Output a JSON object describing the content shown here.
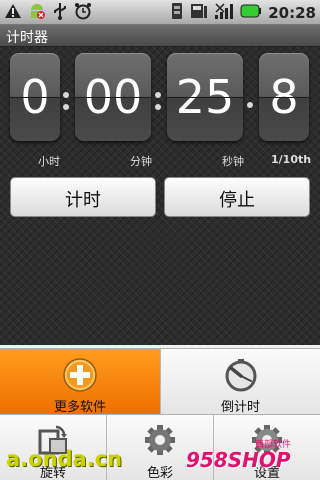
{
  "status_bar": {
    "time": "20:28",
    "icons": [
      "warning-icon",
      "android-notify-icon",
      "usb-icon",
      "alarm-icon",
      "sim-icon",
      "sdcard-icon",
      "signal-icon",
      "battery-icon"
    ]
  },
  "app": {
    "title": "计时器"
  },
  "timer": {
    "hours": "0",
    "minutes": "00",
    "seconds": "25",
    "tenths": "8",
    "labels": {
      "hours": "小时",
      "minutes": "分钟",
      "seconds": "秒钟",
      "tenths": "1/10th"
    }
  },
  "buttons": {
    "start": "计时",
    "stop": "停止"
  },
  "menu": {
    "items": [
      {
        "label": "更多软件",
        "icon": "plus-icon",
        "active": true
      },
      {
        "label": "倒计时",
        "icon": "countdown-dial-icon",
        "active": false
      },
      {
        "label": "旋转",
        "icon": "rotate-icon",
        "active": false
      },
      {
        "label": "色彩",
        "icon": "gear-icon",
        "active": false
      },
      {
        "label": "设置",
        "icon": "settings-icon",
        "active": false
      }
    ]
  },
  "watermarks": {
    "left": "a.onda.cn",
    "right_main": "958SHOP",
    "right_sub": "西部软件"
  },
  "colors": {
    "accent": "#f57c00",
    "menu_bg": "#f2f2f2",
    "watermark_green": "#c9d300",
    "watermark_pink": "#e0116f"
  }
}
